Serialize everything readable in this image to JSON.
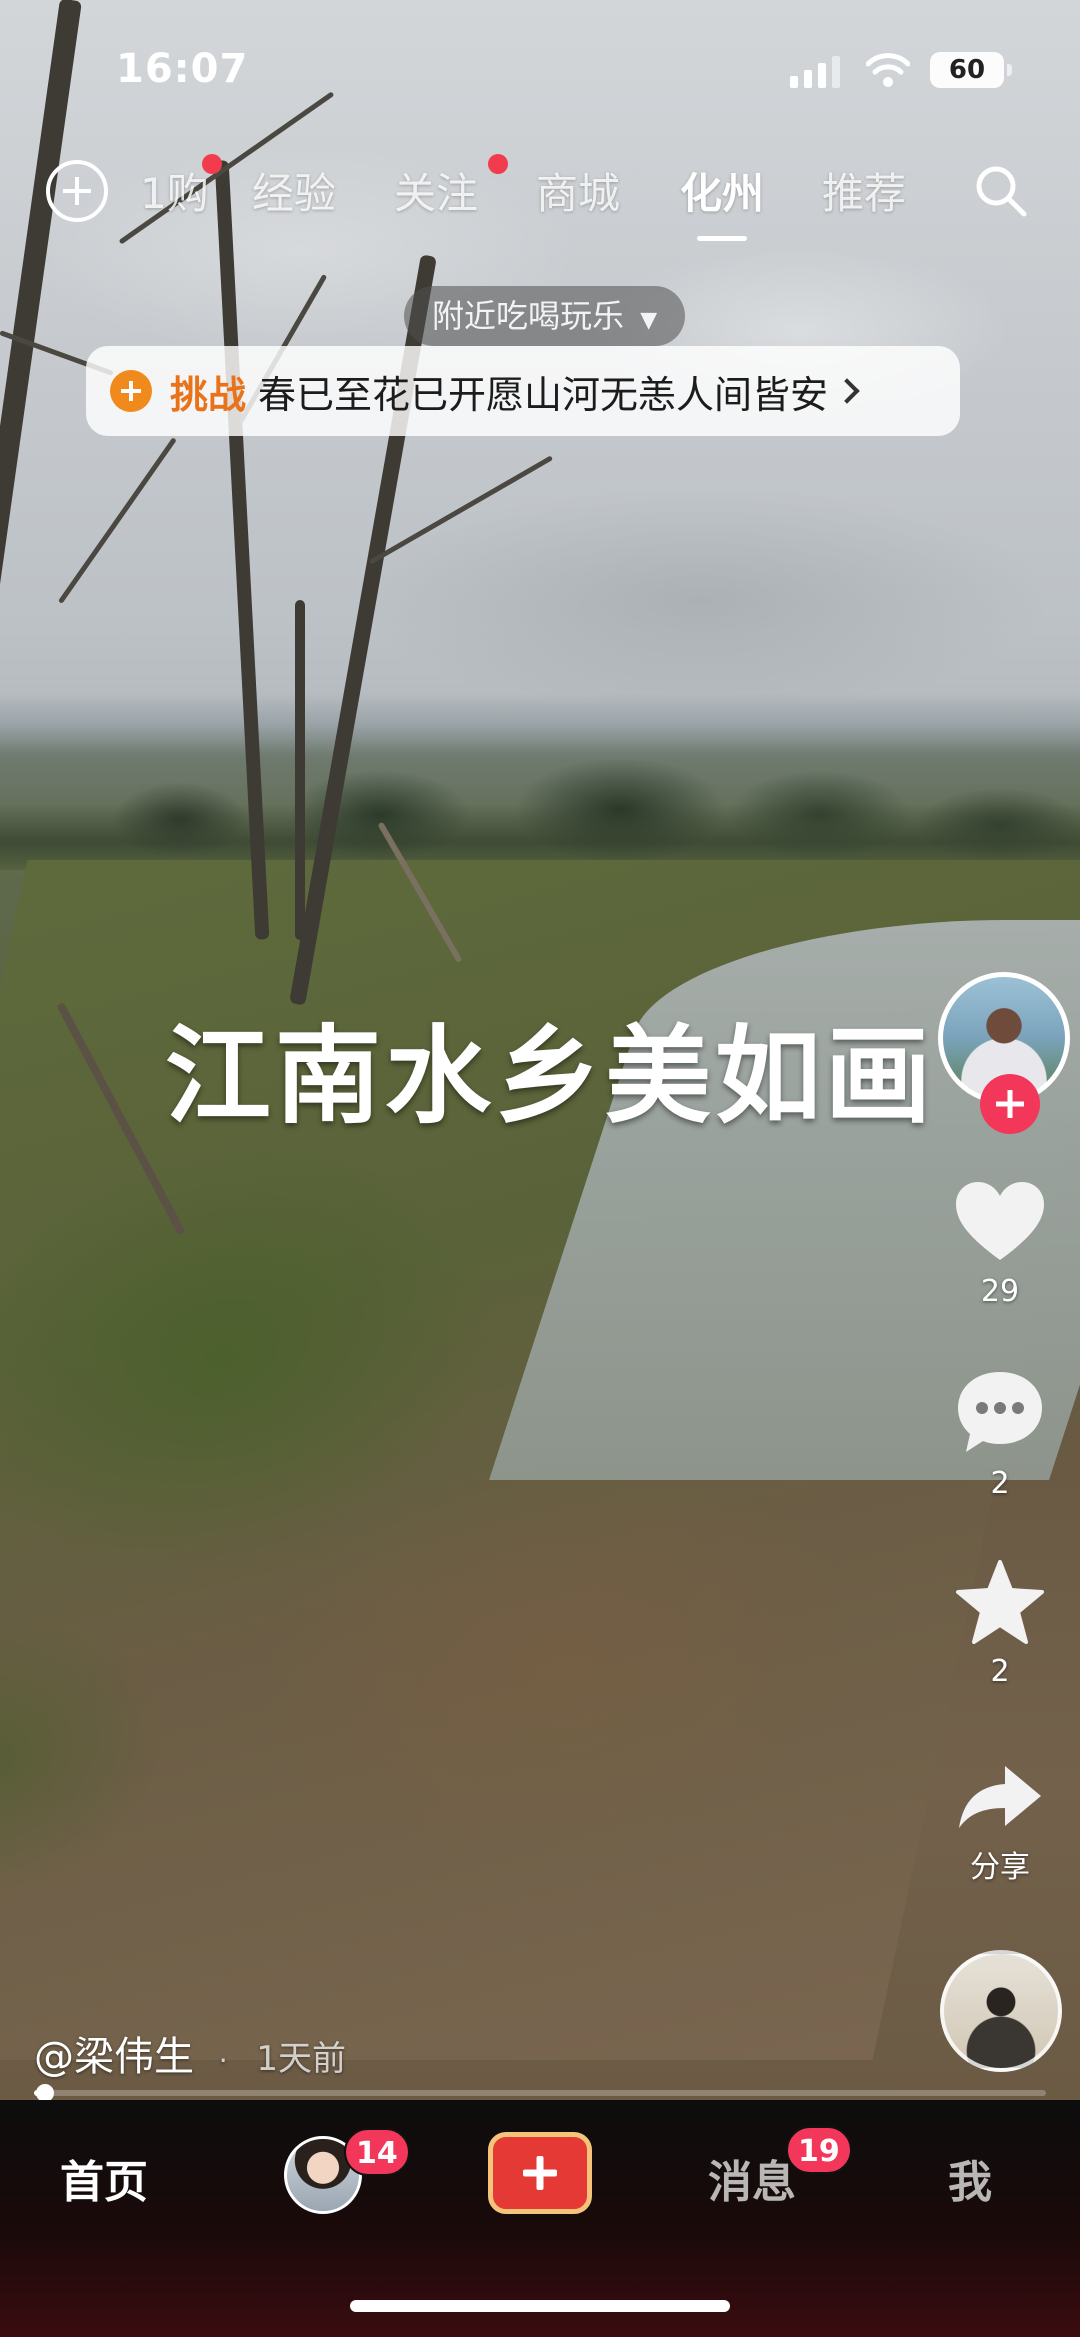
{
  "status_bar": {
    "time": "16:07",
    "battery": "60"
  },
  "top_nav": {
    "tabs": [
      {
        "label": "1购",
        "has_dot": true
      },
      {
        "label": "经验",
        "has_dot": false
      },
      {
        "label": "关注",
        "has_dot": true
      },
      {
        "label": "商城",
        "has_dot": false
      },
      {
        "label": "化州",
        "active": true
      },
      {
        "label": "推荐",
        "has_dot": false
      }
    ],
    "icons": {
      "left": "add-circle-icon",
      "right": "search-icon"
    }
  },
  "nearby_label": "附近吃喝玩乐",
  "challenge": {
    "tag": "挑战",
    "text": "春已至花已开愿山河无恙人间皆安"
  },
  "video": {
    "overlay_title": "江南水乡美如画",
    "author": "@梁伟生",
    "time_ago": "1天前",
    "progress": 0.006
  },
  "actions": {
    "likes": "29",
    "comments": "2",
    "favorites": "2",
    "share_label": "分享"
  },
  "tab_bar": {
    "home": "首页",
    "friends_badge": "14",
    "messages": "消息",
    "messages_badge": "19",
    "me": "我"
  },
  "colors": {
    "accent_red": "#f2375a",
    "challenge_orange": "#e8731a",
    "create_gold": "#f3c47a"
  }
}
